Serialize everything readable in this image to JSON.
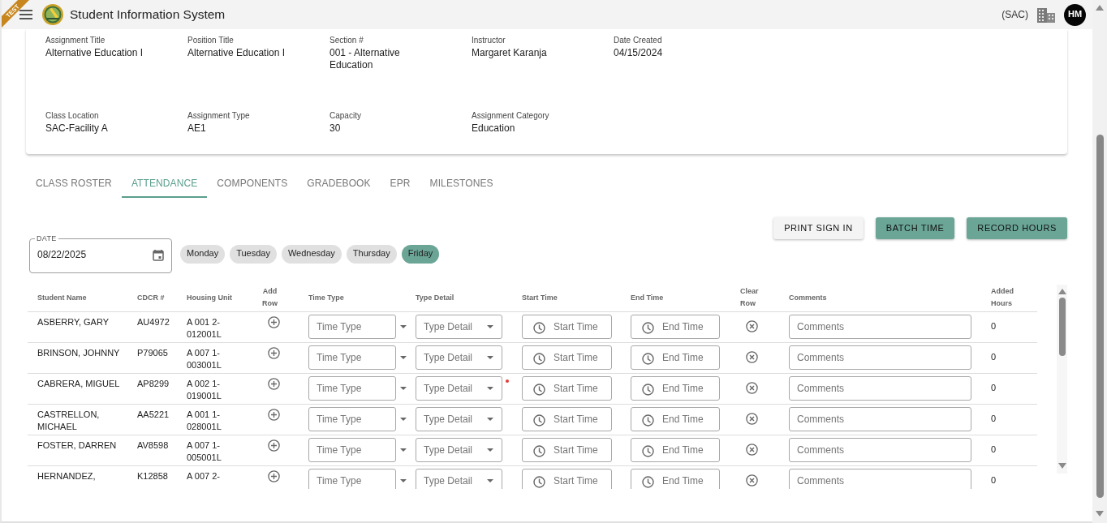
{
  "header": {
    "ribbon": "TEST",
    "title": "Student Information System",
    "facility": "(SAC)",
    "avatar": "HM"
  },
  "details": [
    [
      {
        "label": "Assignment Title",
        "value": "Alternative Education I"
      },
      {
        "label": "Position Title",
        "value": "Alternative Education I"
      },
      {
        "label": "Section #",
        "value": "001 - Alternative Education"
      },
      {
        "label": "Instructor",
        "value": "Margaret Karanja"
      },
      {
        "label": "Date Created",
        "value": "04/15/2024"
      }
    ],
    [
      {
        "label": "Class Location",
        "value": "SAC-Facility A"
      },
      {
        "label": "Assignment Type",
        "value": "AE1"
      },
      {
        "label": "Capacity",
        "value": "30"
      },
      {
        "label": "Assignment Category",
        "value": "Education"
      }
    ]
  ],
  "tabs": [
    {
      "label": "CLASS ROSTER",
      "selected": false
    },
    {
      "label": "ATTENDANCE",
      "selected": true
    },
    {
      "label": "COMPONENTS",
      "selected": false
    },
    {
      "label": "GRADEBOOK",
      "selected": false
    },
    {
      "label": "EPR",
      "selected": false
    },
    {
      "label": "MILESTONES",
      "selected": false
    }
  ],
  "actions": [
    {
      "label": "PRINT SIGN IN",
      "kind": "secondary"
    },
    {
      "label": "BATCH TIME",
      "kind": "primary"
    },
    {
      "label": "RECORD HOURS",
      "kind": "primary"
    }
  ],
  "date_field": {
    "label": "DATE",
    "value": "08/22/2025"
  },
  "days": [
    {
      "label": "Monday",
      "selected": false
    },
    {
      "label": "Tuesday",
      "selected": false
    },
    {
      "label": "Wednesday",
      "selected": false
    },
    {
      "label": "Thursday",
      "selected": false
    },
    {
      "label": "Friday",
      "selected": true
    }
  ],
  "table": {
    "columns": [
      "Student Name",
      "CDCR #",
      "Housing Unit",
      "Add Row",
      "Time Type",
      "Type Detail",
      "Start Time",
      "End Time",
      "Clear Row",
      "Comments",
      "Added Hours"
    ],
    "rows": [
      {
        "student_name": "ASBERRY, GARY",
        "cdcr": "AU4972",
        "housing_unit": "A 001 2-012001L",
        "time_type": {
          "placeholder": "Time Type"
        },
        "type_detail": {
          "placeholder": "Type Detail"
        },
        "start_time": {
          "placeholder": "Start Time"
        },
        "end_time": {
          "placeholder": "End Time"
        },
        "comments": {
          "placeholder": "Comments"
        },
        "added_hours": "0",
        "flagged": false
      },
      {
        "student_name": "BRINSON, JOHNNY",
        "cdcr": "P79065",
        "housing_unit": "A 007 1-003001L",
        "time_type": {
          "placeholder": "Time Type"
        },
        "type_detail": {
          "placeholder": "Type Detail"
        },
        "start_time": {
          "placeholder": "Start Time"
        },
        "end_time": {
          "placeholder": "End Time"
        },
        "comments": {
          "placeholder": "Comments"
        },
        "added_hours": "0",
        "flagged": false
      },
      {
        "student_name": "CABRERA, MIGUEL",
        "cdcr": "AP8299",
        "housing_unit": "A 002 1-019001L",
        "time_type": {
          "placeholder": "Time Type"
        },
        "type_detail": {
          "placeholder": "Type Detail"
        },
        "start_time": {
          "placeholder": "Start Time"
        },
        "end_time": {
          "placeholder": "End Time"
        },
        "comments": {
          "placeholder": "Comments"
        },
        "added_hours": "0",
        "flagged": true
      },
      {
        "student_name": "CASTRELLON, MICHAEL",
        "cdcr": "AA5221",
        "housing_unit": "A 001 1-028001L",
        "time_type": {
          "placeholder": "Time Type"
        },
        "type_detail": {
          "placeholder": "Type Detail"
        },
        "start_time": {
          "placeholder": "Start Time"
        },
        "end_time": {
          "placeholder": "End Time"
        },
        "comments": {
          "placeholder": "Comments"
        },
        "added_hours": "0",
        "flagged": false
      },
      {
        "student_name": "FOSTER, DARREN",
        "cdcr": "AV8598",
        "housing_unit": "A 007 1-005001L",
        "time_type": {
          "placeholder": "Time Type"
        },
        "type_detail": {
          "placeholder": "Type Detail"
        },
        "start_time": {
          "placeholder": "Start Time"
        },
        "end_time": {
          "placeholder": "End Time"
        },
        "comments": {
          "placeholder": "Comments"
        },
        "added_hours": "0",
        "flagged": false
      },
      {
        "student_name": "HERNANDEZ,",
        "cdcr": "K12858",
        "housing_unit": "A 007 2-",
        "time_type": {
          "placeholder": "Time Type"
        },
        "type_detail": {
          "placeholder": "Type Detail"
        },
        "start_time": {
          "placeholder": "Start Time"
        },
        "end_time": {
          "placeholder": "End Time"
        },
        "comments": {
          "placeholder": "Comments"
        },
        "added_hours": "0",
        "flagged": false
      }
    ]
  }
}
